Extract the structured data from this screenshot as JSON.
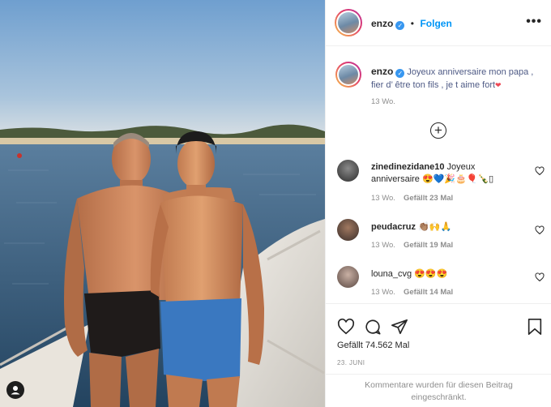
{
  "header": {
    "username": "enzo",
    "verified_mark": "✓",
    "separator": "•",
    "follow_label": "Folgen",
    "more_label": "•••"
  },
  "caption": {
    "username": "enzo",
    "text": "Joyeux anniversaire mon papa , fier d’ être ton fils , je t aime fort",
    "emoji": "❤",
    "time": "13 Wo."
  },
  "load_more_label": "+",
  "comments": [
    {
      "username": "zinedinezidane10",
      "text": "Joyeux anniversaire 😍💙🎉🎂🎈🍾▯",
      "time": "13 Wo.",
      "likes": "Gefällt 23 Mal"
    },
    {
      "username": "peudacruz",
      "text": "👏🏽🙌🙏",
      "time": "13 Wo.",
      "likes": "Gefällt 19 Mal"
    },
    {
      "username": "louna_cvg",
      "text": "😍😍😍",
      "time": "13 Wo.",
      "likes": "Gefällt 14 Mal"
    }
  ],
  "actions": {
    "icons": [
      "heart-icon",
      "comment-icon",
      "share-icon",
      "bookmark-icon"
    ],
    "likes_text": "Gefällt 74.562 Mal",
    "date": "23. JUNI",
    "restricted_text": "Kommentare wurden für diesen Beitrag eingeschränkt."
  },
  "colors": {
    "accent": "#0095f6",
    "verified": "#3897f0",
    "muted": "#8e8e8e"
  }
}
